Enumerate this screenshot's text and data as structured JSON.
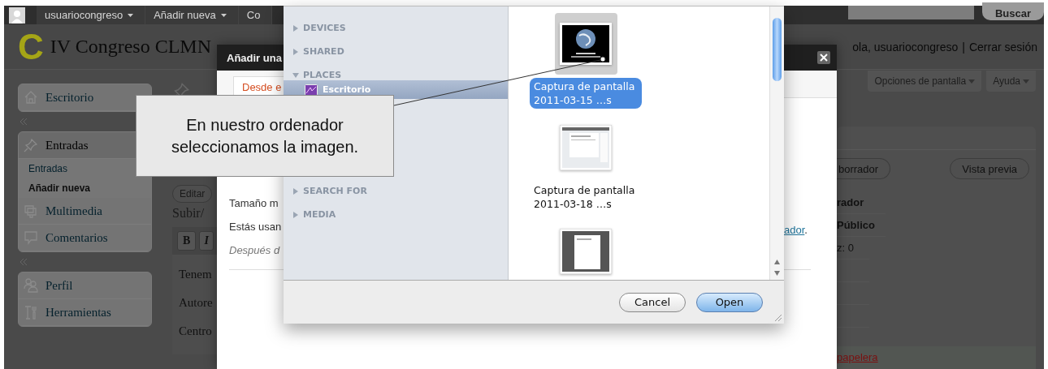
{
  "admin_bar": {
    "items": [
      {
        "label": "usuariocongreso",
        "caret": true
      },
      {
        "label": "Añadir nueva",
        "caret": true
      },
      {
        "label": "Co",
        "caret": false
      }
    ],
    "search_button": "Buscar"
  },
  "header": {
    "logo": "C",
    "site_title": "IV Congreso CLMN",
    "greeting": "ola,",
    "user": "usuariocongreso",
    "separator": "|",
    "logout": "Cerrar sesión"
  },
  "screen_tabs": [
    "Opciones de pantalla",
    "Ayuda"
  ],
  "sidebar": {
    "groups": [
      {
        "items": [
          {
            "label": "Escritorio",
            "expanded": false
          }
        ]
      },
      {
        "items": [
          {
            "label": "Entradas",
            "expanded": true,
            "children": [
              {
                "label": "Entradas",
                "selected": false
              },
              {
                "label": "Añadir nueva",
                "selected": true
              }
            ]
          },
          {
            "label": "Multimedia",
            "expanded": false
          },
          {
            "label": "Comentarios",
            "expanded": false
          }
        ]
      },
      {
        "items": [
          {
            "label": "Perfil",
            "expanded": false
          },
          {
            "label": "Herramientas",
            "expanded": false
          }
        ]
      }
    ]
  },
  "editor": {
    "edit_button": "Editar",
    "upload_label": "Subir/",
    "toolbar": [
      "B",
      "I"
    ],
    "fields": [
      "Tenem",
      "Autore",
      "Centro"
    ]
  },
  "publish_box": {
    "buttons": [
      "borrador",
      "Vista previa"
    ],
    "lines": [
      {
        "text": "rador",
        "bold": true
      },
      {
        "text": "Público",
        "bold": true
      },
      {
        "text": "z: 0",
        "bold": false
      }
    ],
    "trash_link": "papelera"
  },
  "modal": {
    "title": "Añadir una",
    "tab": "Desde e",
    "lines": [
      "Tamaño m",
      "Estás usan"
    ],
    "link": "ador",
    "link_suffix": ".",
    "note": "Después d"
  },
  "file_dialog": {
    "sidebar": [
      {
        "label": "DEVICES",
        "expanded": false
      },
      {
        "label": "SHARED",
        "expanded": false
      },
      {
        "label": "PLACES",
        "expanded": true,
        "children": [
          {
            "label": "Escritorio",
            "selected": true
          }
        ]
      },
      {
        "label": "SEARCH FOR",
        "expanded": false
      },
      {
        "label": "MEDIA",
        "expanded": false
      }
    ],
    "files": [
      {
        "kind": "photo",
        "name_lines": [
          "Captura de pantalla",
          "2011-03-15 …s"
        ],
        "selected": true
      },
      {
        "kind": "screenshot",
        "name_lines": [
          "Captura de pantalla",
          "2011-03-18 …s"
        ],
        "selected": false
      },
      {
        "kind": "dark-screenshot",
        "selected": false
      }
    ],
    "buttons": [
      {
        "label": "Cancel",
        "default": false
      },
      {
        "label": "Open",
        "default": true
      }
    ]
  },
  "callout": {
    "text": "En nuestro ordenador seleccionamos la imagen."
  }
}
